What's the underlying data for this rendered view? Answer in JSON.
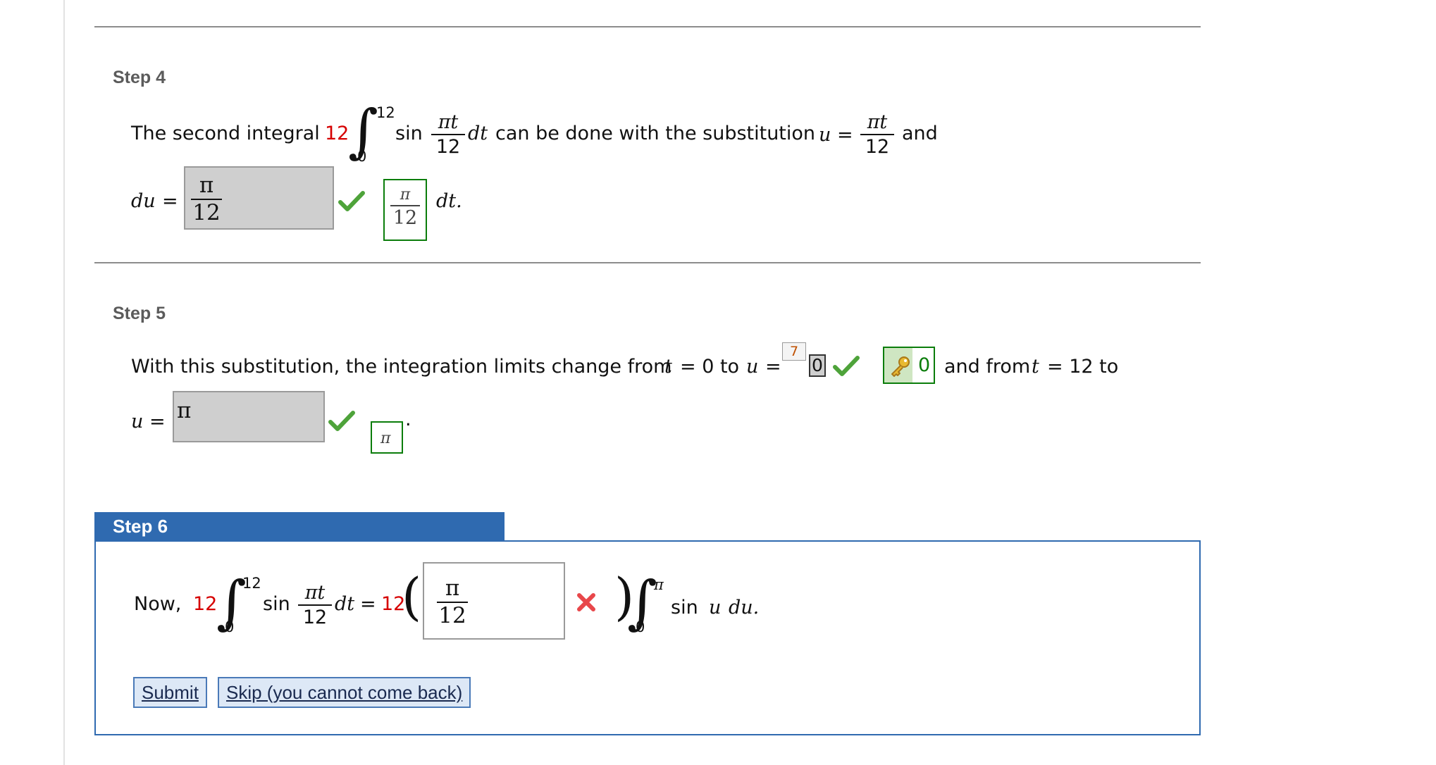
{
  "step4": {
    "heading": "Step 4",
    "text_before": "The second integral",
    "coef": "12",
    "upper": "12",
    "lower": "0",
    "sin": "sin",
    "frac_num": "πt",
    "frac_den": "12",
    "dt": "dt",
    "text_mid": "can be done with the substitution",
    "u_label": "u",
    "eq": "=",
    "u_num": "πt",
    "u_den": "12",
    "text_end": "and",
    "du_label": "du",
    "du_eq": "=",
    "input_num": "π",
    "input_den": "12",
    "answer_num": "π",
    "answer_den": "12",
    "after": "dt."
  },
  "step5": {
    "heading": "Step 5",
    "text1": "With this substitution, the integration limits change from",
    "t": "t",
    "eq0": "= 0 to",
    "u": "u",
    "eq": "=",
    "badge": "7",
    "input1_value": "0",
    "answer1_value": "0",
    "text2": "and from",
    "t2": "t",
    "eq12": "= 12 to",
    "u2": "u",
    "eq2": "=",
    "input2_value": "π",
    "answer2_value": "π",
    "period": "."
  },
  "step6": {
    "heading": "Step 6",
    "now": "Now,",
    "coef": "12",
    "upper": "12",
    "lower": "0",
    "sin": "sin",
    "frac_num": "πt",
    "frac_den": "12",
    "dt": "dt",
    "eq": "=",
    "coef2": "12",
    "input_num": "π",
    "input_den": "12",
    "upper2": "π",
    "lower2": "0",
    "sin2": "sin",
    "u": "u",
    "du": "du."
  },
  "buttons": {
    "submit": "Submit",
    "skip": "Skip (you cannot come back)"
  },
  "colors": {
    "step6_tab": "#2f6ab0",
    "correct_green": "#0b7d0b",
    "red_coef": "#d60000",
    "error_red": "#e8474a"
  }
}
